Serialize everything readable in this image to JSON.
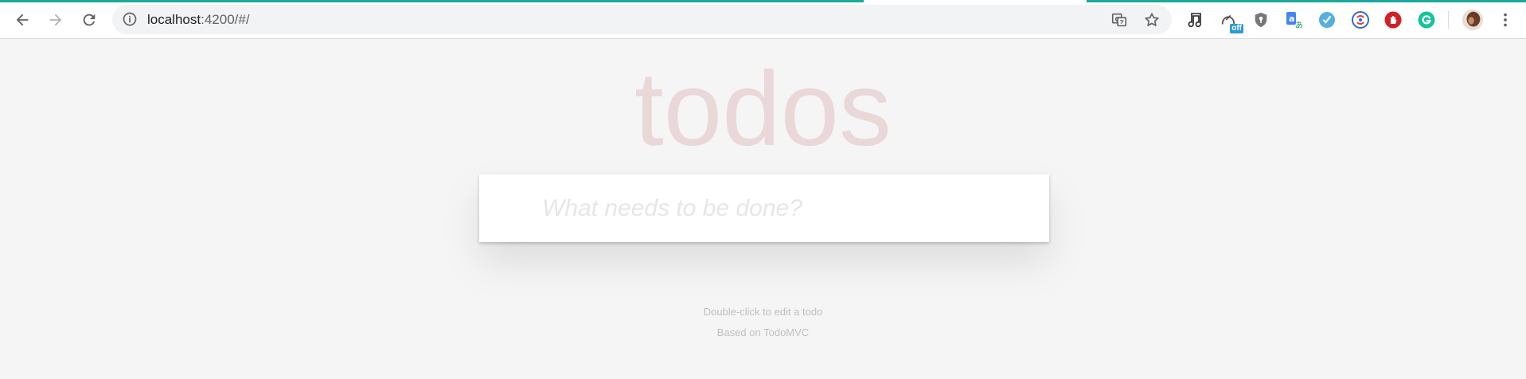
{
  "browser": {
    "url_host": "localhost",
    "url_path": ":4200/#/",
    "icons": {
      "back": "arrow-left-icon",
      "forward": "arrow-right-icon",
      "reload": "reload-icon",
      "site_info": "info-icon",
      "translate": "translate-icon",
      "bookmark": "star-icon"
    },
    "extensions": [
      {
        "name": "music-note-extension-icon"
      },
      {
        "name": "off-extension-icon",
        "badge": "off"
      },
      {
        "name": "shield-extension-icon"
      },
      {
        "name": "translate-a-extension-icon"
      },
      {
        "name": "checkmark-extension-icon"
      },
      {
        "name": "sync-extension-icon"
      },
      {
        "name": "stop-hand-extension-icon"
      },
      {
        "name": "grammarly-extension-icon"
      }
    ],
    "accent": "#1aa99e"
  },
  "app": {
    "title": "todos",
    "new_todo_placeholder": "What needs to be done?",
    "footer": {
      "hint": "Double-click to edit a todo",
      "credit": "Based on TodoMVC"
    },
    "colors": {
      "title": "rgba(175,47,47,0.15)",
      "background": "#f5f5f5",
      "footer_text": "#bfbfbf"
    }
  }
}
